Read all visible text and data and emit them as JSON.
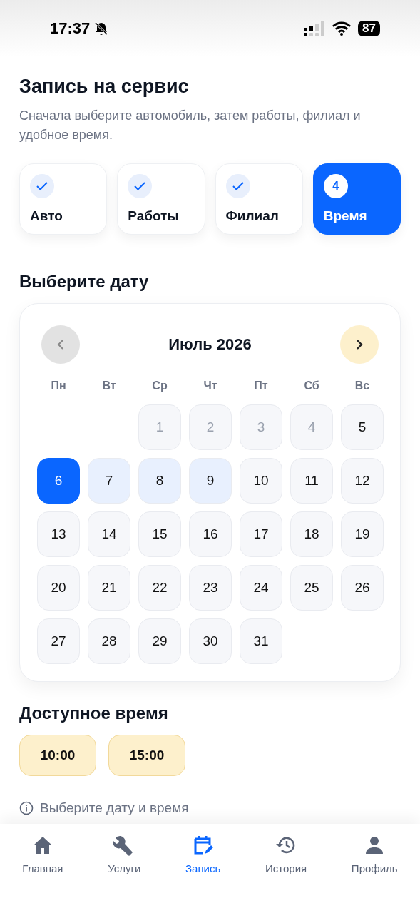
{
  "status_bar": {
    "time": "17:37",
    "battery": "87"
  },
  "header": {
    "title": "Запись на сервис",
    "subtitle": "Сначала выберите автомобиль, затем работы, филиал и удобное время."
  },
  "steps": [
    {
      "label": "Авто",
      "done": true,
      "selected": false
    },
    {
      "label": "Работы",
      "done": true,
      "selected": false
    },
    {
      "label": "Филиал",
      "done": true,
      "selected": false
    },
    {
      "label": "Время",
      "number": "4",
      "done": false,
      "selected": true
    }
  ],
  "date_section": {
    "title": "Выберите дату"
  },
  "calendar": {
    "month": "Июль 2026",
    "prev_disabled": true,
    "weekdays": [
      "Пн",
      "Вт",
      "Ср",
      "Чт",
      "Пт",
      "Сб",
      "Вс"
    ],
    "days": [
      {
        "kind": "blank"
      },
      {
        "kind": "blank"
      },
      {
        "kind": "day",
        "label": "1",
        "disabled": true,
        "highlighted": false,
        "selected": false
      },
      {
        "kind": "day",
        "label": "2",
        "disabled": true,
        "highlighted": false,
        "selected": false
      },
      {
        "kind": "day",
        "label": "3",
        "disabled": true,
        "highlighted": false,
        "selected": false
      },
      {
        "kind": "day",
        "label": "4",
        "disabled": true,
        "highlighted": false,
        "selected": false
      },
      {
        "kind": "day",
        "label": "5",
        "disabled": false,
        "highlighted": false,
        "selected": false
      },
      {
        "kind": "day",
        "label": "6",
        "disabled": false,
        "highlighted": false,
        "selected": true
      },
      {
        "kind": "day",
        "label": "7",
        "disabled": false,
        "highlighted": true,
        "selected": false
      },
      {
        "kind": "day",
        "label": "8",
        "disabled": false,
        "highlighted": true,
        "selected": false
      },
      {
        "kind": "day",
        "label": "9",
        "disabled": false,
        "highlighted": true,
        "selected": false
      },
      {
        "kind": "day",
        "label": "10",
        "disabled": false,
        "highlighted": false,
        "selected": false
      },
      {
        "kind": "day",
        "label": "11",
        "disabled": false,
        "highlighted": false,
        "selected": false
      },
      {
        "kind": "day",
        "label": "12",
        "disabled": false,
        "highlighted": false,
        "selected": false
      },
      {
        "kind": "day",
        "label": "13",
        "disabled": false,
        "highlighted": false,
        "selected": false
      },
      {
        "kind": "day",
        "label": "14",
        "disabled": false,
        "highlighted": false,
        "selected": false
      },
      {
        "kind": "day",
        "label": "15",
        "disabled": false,
        "highlighted": false,
        "selected": false
      },
      {
        "kind": "day",
        "label": "16",
        "disabled": false,
        "highlighted": false,
        "selected": false
      },
      {
        "kind": "day",
        "label": "17",
        "disabled": false,
        "highlighted": false,
        "selected": false
      },
      {
        "kind": "day",
        "label": "18",
        "disabled": false,
        "highlighted": false,
        "selected": false
      },
      {
        "kind": "day",
        "label": "19",
        "disabled": false,
        "highlighted": false,
        "selected": false
      },
      {
        "kind": "day",
        "label": "20",
        "disabled": false,
        "highlighted": false,
        "selected": false
      },
      {
        "kind": "day",
        "label": "21",
        "disabled": false,
        "highlighted": false,
        "selected": false
      },
      {
        "kind": "day",
        "label": "22",
        "disabled": false,
        "highlighted": false,
        "selected": false
      },
      {
        "kind": "day",
        "label": "23",
        "disabled": false,
        "highlighted": false,
        "selected": false
      },
      {
        "kind": "day",
        "label": "24",
        "disabled": false,
        "highlighted": false,
        "selected": false
      },
      {
        "kind": "day",
        "label": "25",
        "disabled": false,
        "highlighted": false,
        "selected": false
      },
      {
        "kind": "day",
        "label": "26",
        "disabled": false,
        "highlighted": false,
        "selected": false
      },
      {
        "kind": "day",
        "label": "27",
        "disabled": false,
        "highlighted": false,
        "selected": false
      },
      {
        "kind": "day",
        "label": "28",
        "disabled": false,
        "highlighted": false,
        "selected": false
      },
      {
        "kind": "day",
        "label": "29",
        "disabled": false,
        "highlighted": false,
        "selected": false
      },
      {
        "kind": "day",
        "label": "30",
        "disabled": false,
        "highlighted": false,
        "selected": false
      },
      {
        "kind": "day",
        "label": "31",
        "disabled": false,
        "highlighted": false,
        "selected": false
      }
    ]
  },
  "time_section": {
    "title": "Доступное время",
    "slots": [
      {
        "label": "10:00",
        "selected": false
      },
      {
        "label": "15:00",
        "selected": false
      }
    ]
  },
  "hint": "Выберите дату и время",
  "nav": [
    {
      "kind": "home",
      "label": "Главная",
      "selected": false
    },
    {
      "kind": "services",
      "label": "Услуги",
      "selected": false
    },
    {
      "kind": "booking",
      "label": "Запись",
      "selected": true
    },
    {
      "kind": "history",
      "label": "История",
      "selected": false
    },
    {
      "kind": "profile",
      "label": "Профиль",
      "selected": false
    }
  ]
}
